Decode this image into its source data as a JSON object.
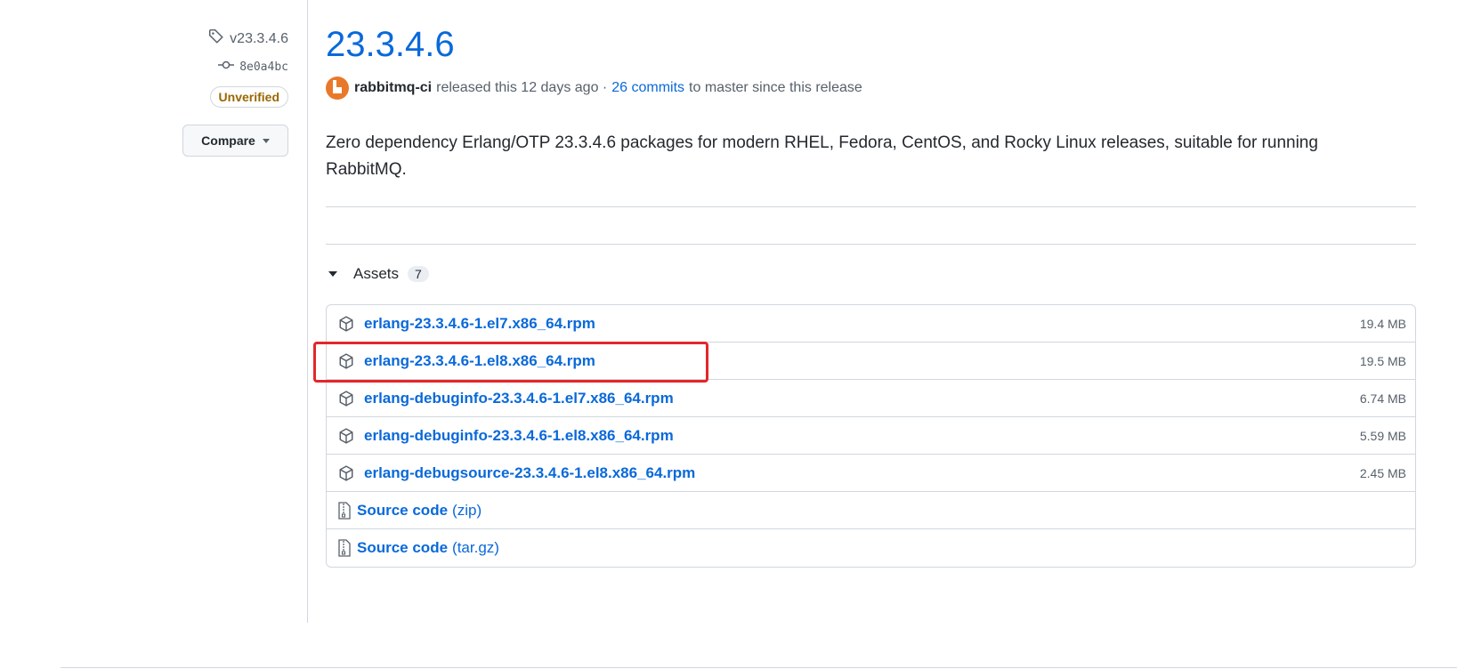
{
  "sidebar": {
    "tag": "v23.3.4.6",
    "commit": "8e0a4bc",
    "verification_badge": "Unverified",
    "compare_label": "Compare"
  },
  "release": {
    "title": "23.3.4.6",
    "author": "rabbitmq-ci",
    "released_text": "released this 12 days ago ·",
    "commits_link": "26 commits",
    "since_text": "to master since this release",
    "description": "Zero dependency Erlang/OTP 23.3.4.6 packages for modern RHEL, Fedora, CentOS, and Rocky Linux releases, suitable for running RabbitMQ."
  },
  "assets": {
    "label": "Assets",
    "count": "7",
    "items": [
      {
        "name": "erlang-23.3.4.6-1.el7.x86_64.rpm",
        "size": "19.4 MB"
      },
      {
        "name": "erlang-23.3.4.6-1.el8.x86_64.rpm",
        "size": "19.5 MB"
      },
      {
        "name": "erlang-debuginfo-23.3.4.6-1.el7.x86_64.rpm",
        "size": "6.74 MB"
      },
      {
        "name": "erlang-debuginfo-23.3.4.6-1.el8.x86_64.rpm",
        "size": "5.59 MB"
      },
      {
        "name": "erlang-debugsource-23.3.4.6-1.el8.x86_64.rpm",
        "size": "2.45 MB"
      }
    ],
    "source": [
      {
        "name": "Source code",
        "suffix": "(zip)"
      },
      {
        "name": "Source code",
        "suffix": "(tar.gz)"
      }
    ]
  },
  "colors": {
    "link": "#0969da",
    "highlight": "#e3262b",
    "unverified": "#9a6700",
    "avatar": "#e8792b"
  }
}
